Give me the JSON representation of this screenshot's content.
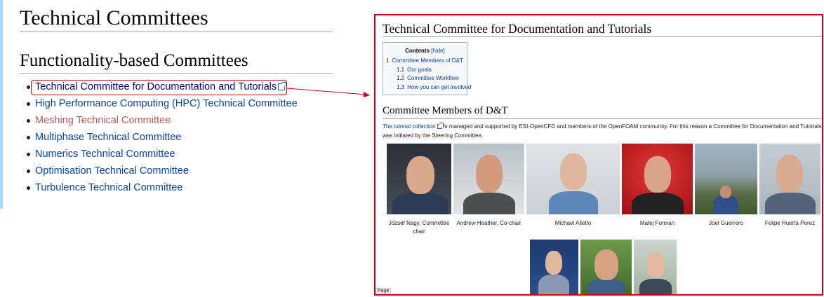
{
  "page": {
    "title": "Technical Committees",
    "section_title": "Functionality-based Committees",
    "committees": [
      {
        "label": "Technical Committee for Documentation and Tutorials",
        "style": "visited",
        "external": true
      },
      {
        "label": "High Performance Computing (HPC) Technical Committee",
        "style": "link",
        "external": false
      },
      {
        "label": "Meshing Technical Committee",
        "style": "red",
        "external": false
      },
      {
        "label": "Multiphase Technical Committee",
        "style": "link",
        "external": false
      },
      {
        "label": "Numerics Technical Committee",
        "style": "link",
        "external": false
      },
      {
        "label": "Optimisation Technical Committee",
        "style": "link",
        "external": false
      },
      {
        "label": "Turbulence Technical Committee",
        "style": "link",
        "external": false
      }
    ]
  },
  "panel": {
    "title": "Technical Committee for Documentation and Tutorials",
    "toc": {
      "heading": "Contents",
      "hide_label": "[hide]",
      "items": [
        {
          "num": "1",
          "label": "Committee Members of D&T"
        },
        {
          "num": "1.1",
          "label": "Our goals"
        },
        {
          "num": "1.2",
          "label": "Committee Workflow"
        },
        {
          "num": "1.3",
          "label": "How you can get involved"
        }
      ]
    },
    "section": "Committee Members of D&T",
    "intro_link": "The tutorial collection",
    "intro_text": " is managed and supported by ESI-OpenCFD and members of the OpenFOAM community. For this reason a Committee for Documentation and Tutorials was initiated by the Steering Committee.",
    "members": [
      {
        "caption": "József Nagy, Committee chair"
      },
      {
        "caption": "Andrew Heather, Co-chair"
      },
      {
        "caption": "Michael Alletto"
      },
      {
        "caption": "Matej Forman"
      },
      {
        "caption": "Joel Guerrero"
      },
      {
        "caption": "Felipe Huerta Perez"
      }
    ],
    "page_label": "Page"
  },
  "colors": {
    "link": "#0645ad",
    "visited": "#0b0080",
    "redlink": "#ba5a5a",
    "highlight": "#d0021b"
  }
}
